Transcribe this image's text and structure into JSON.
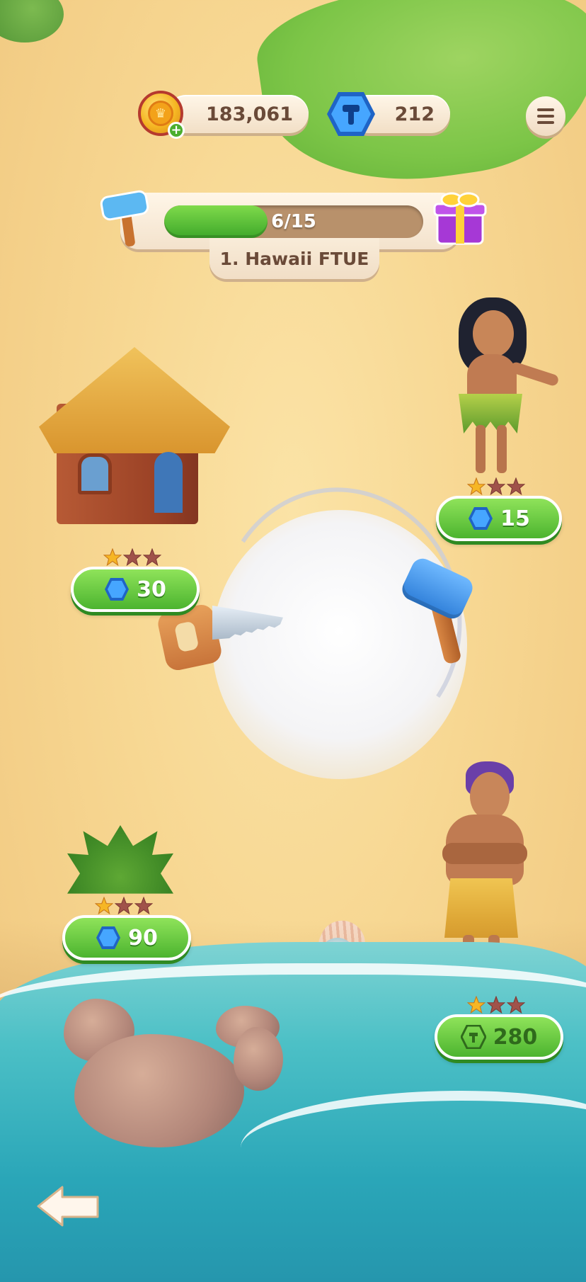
{
  "hud": {
    "coins": "183,061",
    "gems": "212"
  },
  "progress": {
    "text": "6/15",
    "current": 6,
    "total": 15,
    "level_name": "1. Hawaii FTUE"
  },
  "tasks": [
    {
      "name": "girl",
      "price": "15",
      "stars_filled": 1,
      "stars_total": 3
    },
    {
      "name": "hut",
      "price": "30",
      "stars_filled": 1,
      "stars_total": 3
    },
    {
      "name": "bush",
      "price": "90",
      "stars_filled": 1,
      "stars_total": 3
    },
    {
      "name": "man",
      "price": "280",
      "stars_filled": 1,
      "stars_total": 3
    }
  ],
  "icons": {
    "coin": "crown-coin-icon",
    "gem": "hammer-gem-icon",
    "menu": "hamburger-menu-icon",
    "reward": "gift-box-icon",
    "back": "back-arrow-icon"
  },
  "colors": {
    "sand": "#f7d792",
    "button_green": "#4cb42f",
    "gem_blue": "#2f7fd9",
    "text_brown": "#6a4a38"
  }
}
